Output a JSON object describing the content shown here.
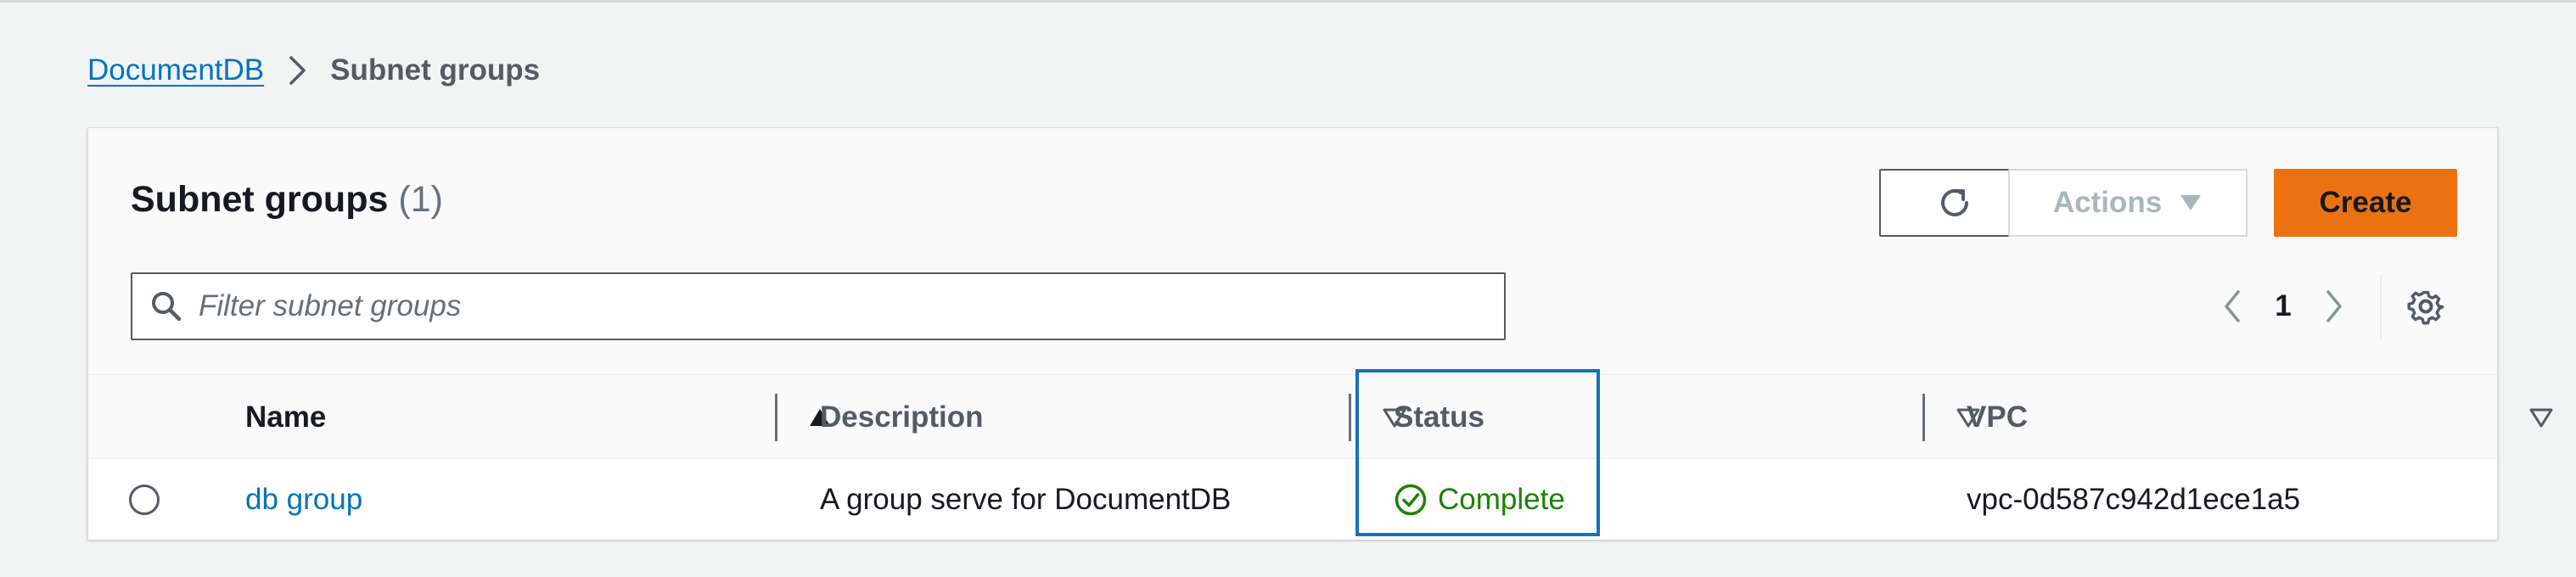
{
  "breadcrumb": {
    "root": "DocumentDB",
    "current": "Subnet groups"
  },
  "panel": {
    "title": "Subnet groups",
    "count": "(1)"
  },
  "toolbar": {
    "refresh_icon": "refresh-icon",
    "actions_label": "Actions",
    "create_label": "Create"
  },
  "search": {
    "placeholder": "Filter subnet groups",
    "value": ""
  },
  "pagination": {
    "current_page": "1",
    "prev_icon": "chevron-left-icon",
    "next_icon": "chevron-right-icon",
    "settings_icon": "gear-icon"
  },
  "table": {
    "columns": [
      {
        "label": "Name",
        "sort": "ascending"
      },
      {
        "label": "Description",
        "sort": "none"
      },
      {
        "label": "Status",
        "sort": "none"
      },
      {
        "label": "VPC",
        "sort": "none"
      }
    ],
    "rows": [
      {
        "selected": false,
        "name": "db group",
        "description": "A group serve for DocumentDB",
        "status": "Complete",
        "status_icon": "check-circle-icon",
        "vpc": "vpc-0d587c942d1ece1a5"
      }
    ]
  },
  "colors": {
    "link": "#0073bb",
    "primary_button": "#ec7211",
    "status_success": "#1d8102",
    "highlight_border": "#1a6fb8"
  }
}
